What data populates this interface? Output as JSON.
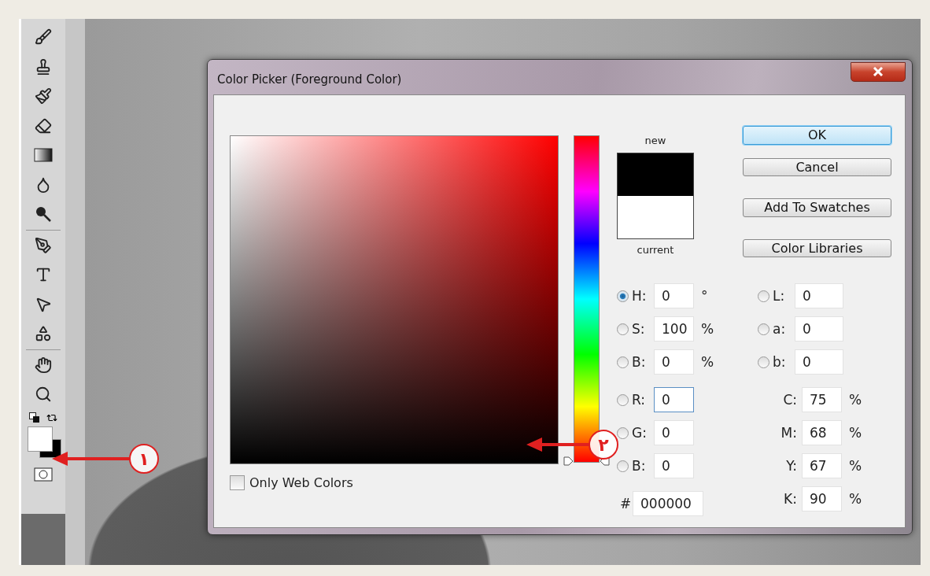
{
  "dialog": {
    "title": "Color Picker (Foreground Color)",
    "hue_slider": {
      "level": 0
    },
    "preview": {
      "new_label": "new",
      "current_label": "current"
    },
    "buttons": [
      {
        "label": "OK",
        "default": true
      },
      {
        "label": "Cancel",
        "default": false
      },
      {
        "label": "Add To Swatches",
        "default": false
      },
      {
        "label": "Color Libraries",
        "default": false
      }
    ],
    "hsb": [
      {
        "label": "H:",
        "value": "0",
        "unit": "°",
        "selected": true
      },
      {
        "label": "S:",
        "value": "100",
        "unit": "%",
        "selected": false
      },
      {
        "label": "B:",
        "value": "0",
        "unit": "%",
        "selected": false
      }
    ],
    "rgb": [
      {
        "label": "R:",
        "value": "0",
        "selected": false,
        "focused": true
      },
      {
        "label": "G:",
        "value": "0",
        "selected": false,
        "focused": false
      },
      {
        "label": "B:",
        "value": "0",
        "selected": false,
        "focused": false
      }
    ],
    "hex": {
      "label": "#",
      "value": "000000"
    },
    "lab": [
      {
        "label": "L:",
        "value": "0",
        "selected": false
      },
      {
        "label": "a:",
        "value": "0",
        "selected": false
      },
      {
        "label": "b:",
        "value": "0",
        "selected": false
      }
    ],
    "cmyk": [
      {
        "label": "C:",
        "value": "75",
        "unit": "%"
      },
      {
        "label": "M:",
        "value": "68",
        "unit": "%"
      },
      {
        "label": "Y:",
        "value": "67",
        "unit": "%"
      },
      {
        "label": "K:",
        "value": "90",
        "unit": "%"
      }
    ],
    "web_colors": {
      "label": "Only Web Colors",
      "checked": false
    }
  },
  "annotations": [
    {
      "label": "۱"
    },
    {
      "label": "۲"
    }
  ]
}
